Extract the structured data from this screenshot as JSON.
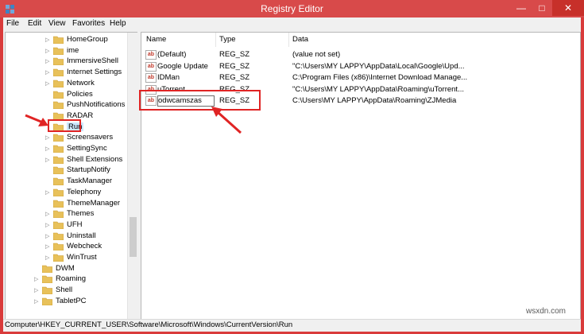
{
  "window": {
    "title": "Registry Editor"
  },
  "title_controls": {
    "minimize": "—",
    "maximize": "□",
    "close": "✕"
  },
  "menu": [
    "File",
    "Edit",
    "View",
    "Favorites",
    "Help"
  ],
  "tree": {
    "items": [
      {
        "label": "HomeGroup",
        "level": 2,
        "expandable": true
      },
      {
        "label": "ime",
        "level": 2,
        "expandable": true
      },
      {
        "label": "ImmersiveShell",
        "level": 2,
        "expandable": true
      },
      {
        "label": "Internet Settings",
        "level": 2,
        "expandable": true
      },
      {
        "label": "Network",
        "level": 2,
        "expandable": true
      },
      {
        "label": "Policies",
        "level": 2,
        "expandable": false
      },
      {
        "label": "PushNotifications",
        "level": 2,
        "expandable": false
      },
      {
        "label": "RADAR",
        "level": 2,
        "expandable": false
      },
      {
        "label": "Run",
        "level": 2,
        "expandable": false,
        "selected": true
      },
      {
        "label": "Screensavers",
        "level": 2,
        "expandable": true
      },
      {
        "label": "SettingSync",
        "level": 2,
        "expandable": true
      },
      {
        "label": "Shell Extensions",
        "level": 2,
        "expandable": true
      },
      {
        "label": "StartupNotify",
        "level": 2,
        "expandable": false
      },
      {
        "label": "TaskManager",
        "level": 2,
        "expandable": false
      },
      {
        "label": "Telephony",
        "level": 2,
        "expandable": true
      },
      {
        "label": "ThemeManager",
        "level": 2,
        "expandable": false
      },
      {
        "label": "Themes",
        "level": 2,
        "expandable": true
      },
      {
        "label": "UFH",
        "level": 2,
        "expandable": true
      },
      {
        "label": "Uninstall",
        "level": 2,
        "expandable": true
      },
      {
        "label": "Webcheck",
        "level": 2,
        "expandable": true
      },
      {
        "label": "WinTrust",
        "level": 2,
        "expandable": true
      },
      {
        "label": "DWM",
        "level": 1,
        "expandable": false
      },
      {
        "label": "Roaming",
        "level": 1,
        "expandable": true
      },
      {
        "label": "Shell",
        "level": 1,
        "expandable": true
      },
      {
        "label": "TabletPC",
        "level": 1,
        "expandable": true
      }
    ]
  },
  "list": {
    "columns": [
      "Name",
      "Type",
      "Data"
    ],
    "rows": [
      {
        "name": "(Default)",
        "type": "REG_SZ",
        "data": "(value not set)"
      },
      {
        "name": "Google Update",
        "type": "REG_SZ",
        "data": "\"C:\\Users\\MY LAPPY\\AppData\\Local\\Google\\Upd..."
      },
      {
        "name": "IDMan",
        "type": "REG_SZ",
        "data": "C:\\Program Files (x86)\\Internet Download Manage..."
      },
      {
        "name": "uTorrent",
        "type": "REG_SZ",
        "data": "\"C:\\Users\\MY LAPPY\\AppData\\Roaming\\uTorrent..."
      },
      {
        "name": "odwcamszas",
        "type": "REG_SZ",
        "data": "C:\\Users\\MY LAPPY\\AppData\\Roaming\\ZJMedia"
      }
    ]
  },
  "status": {
    "path": "Computer\\HKEY_CURRENT_USER\\Software\\Microsoft\\Windows\\CurrentVersion\\Run"
  },
  "watermark": "wsxdn.com",
  "colors": {
    "titlebar": "#d84a4a",
    "annotation": "#e02424",
    "folder": "#e8c15a"
  }
}
